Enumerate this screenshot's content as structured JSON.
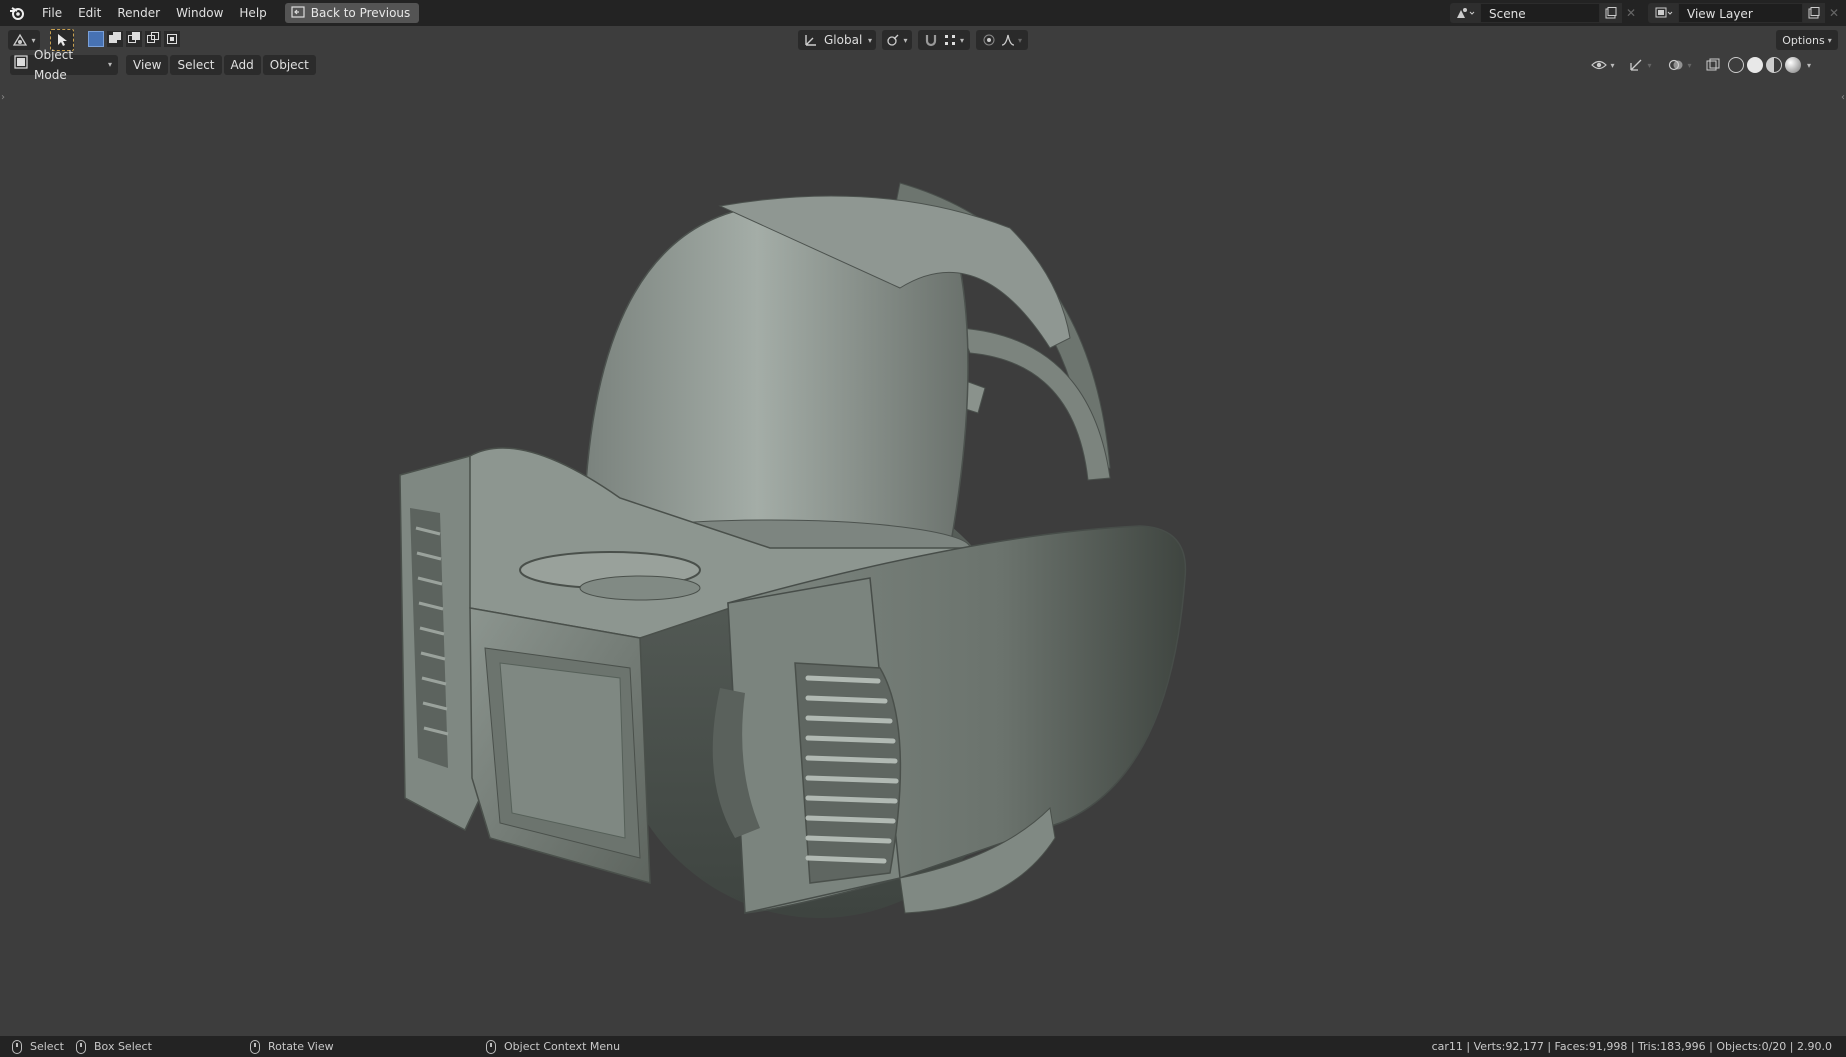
{
  "topbar": {
    "menus": [
      "File",
      "Edit",
      "Render",
      "Window",
      "Help"
    ],
    "back_button": "Back to Previous",
    "scene_field": "Scene",
    "view_layer_field": "View Layer"
  },
  "toolbar": {
    "orientation": "Global",
    "options_label": "Options"
  },
  "header": {
    "mode": "Object Mode",
    "menus": [
      "View",
      "Select",
      "Add",
      "Object"
    ]
  },
  "statusbar": {
    "select": "Select",
    "box_select": "Box Select",
    "rotate_view": "Rotate View",
    "context_menu": "Object Context Menu",
    "stats": "car11 | Verts:92,177 | Faces:91,998 | Tris:183,996 | Objects:0/20 | 2.90.0"
  },
  "colors": {
    "background": "#3d3d3d",
    "topbar": "#232323",
    "model": "#8a938d",
    "selected_accent": "#4772b3"
  }
}
